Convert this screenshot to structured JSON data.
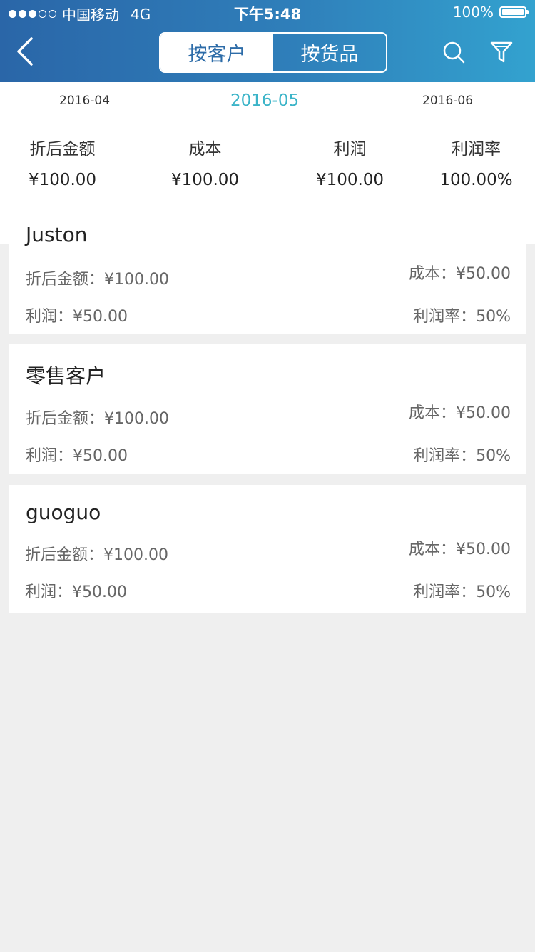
{
  "status_bar": {
    "carrier": "中国移动",
    "network": "4G",
    "time": "下午5:48",
    "battery": "100%"
  },
  "header": {
    "tabs": [
      {
        "label": "按客户",
        "active": true
      },
      {
        "label": "按货品",
        "active": false
      }
    ]
  },
  "months": {
    "prev": "2016-04",
    "current": "2016-05",
    "next": "2016-06"
  },
  "summary": [
    {
      "label": "折后金额",
      "value": "¥100.00"
    },
    {
      "label": "成本",
      "value": "¥100.00"
    },
    {
      "label": "利润",
      "value": "¥100.00"
    },
    {
      "label": "利润率",
      "value": "100.00%"
    }
  ],
  "customers": [
    {
      "name": "Juston",
      "discount_label": "折后金额：",
      "discount": "¥100.00",
      "cost_label": "成本：",
      "cost": "¥50.00",
      "profit_label": "利润：",
      "profit": "¥50.00",
      "margin_label": "利润率：",
      "margin": "50%"
    },
    {
      "name": "零售客户",
      "discount_label": "折后金额：",
      "discount": "¥100.00",
      "cost_label": "成本：",
      "cost": "¥50.00",
      "profit_label": "利润：",
      "profit": "¥50.00",
      "margin_label": "利润率：",
      "margin": "50%"
    },
    {
      "name": "guoguo",
      "discount_label": "折后金额：",
      "discount": "¥100.00",
      "cost_label": "成本：",
      "cost": "¥50.00",
      "profit_label": "利润：",
      "profit": "¥50.00",
      "margin_label": "利润率：",
      "margin": "50%"
    }
  ],
  "colors": {
    "header_start": "#2a66a8",
    "header_end": "#33a2cf",
    "accent": "#3bb4c8",
    "background": "#efefef"
  },
  "icons": [
    "back-chevron-icon",
    "search-icon",
    "filter-icon",
    "battery-icon",
    "signal-dots-icon"
  ]
}
